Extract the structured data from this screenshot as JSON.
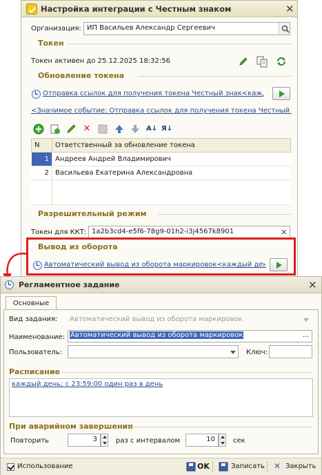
{
  "window1": {
    "title": "Настройка интеграции с Честным знаком",
    "organization_label": "Организация:",
    "organization_value": "ИП Васильев Александр Сергеевич",
    "token_section": "Токен",
    "token_status": "Токен активен до 25.12.2025 18:32:56",
    "update_section": "Обновление токена",
    "update_task_link": "Отправка ссылок для получения токена Честный знак<кажд...",
    "event_link": "<Значимое событие: Отправка ссылок для получения токена Честный ...",
    "table": {
      "columns": [
        "N",
        "Ответственный за обновление токена"
      ],
      "rows": [
        {
          "n": "1",
          "name": "Андреев Андрей Владимирович"
        },
        {
          "n": "2",
          "name": "Васильева Екатерина Александровна"
        }
      ]
    },
    "permit_section": "Разрешительный режим",
    "kkt_label": "Токен для ККТ:",
    "kkt_value": "1a2b3cd4-e5f6-78g9-01h2-i3j4567k8901",
    "withdrawal_section": "Вывод из оборота",
    "withdrawal_link": "Автоматический вывод из оборота маркировок<каждый день..."
  },
  "window2": {
    "title": "Регламентное задание",
    "tab": "Основные",
    "task_type_label": "Вид задания:",
    "task_type_value": "Автоматический вывод из оборота маркировок",
    "name_label": "Наименование:",
    "name_value": "Автоматический вывод из оборота маркировок",
    "user_label": "Пользователь:",
    "user_value": "",
    "key_label": "Ключ:",
    "key_value": "",
    "schedule_section": "Расписание",
    "schedule_link": "каждый день; с 23:59:00 один раз в день",
    "failure_section": "При аварийном завершении",
    "repeat_label": "Повторить",
    "repeat_value": "3",
    "interval_label": "раз с интервалом",
    "interval_value": "10",
    "sec_label": "сек",
    "use_label": "Использование",
    "ok_label": "OK",
    "save_label": "Записать",
    "close_label": "Закрыть"
  },
  "icons": {
    "edit": "pencil-icon",
    "copy": "copy-icon",
    "refresh": "refresh-icon",
    "add": "add-icon",
    "delete": "delete-icon",
    "move_up": "arrow-up-icon",
    "move_down": "arrow-down-icon",
    "sort_asc": "sort-asc-icon",
    "sort_desc": "sort-desc-icon"
  },
  "colors": {
    "highlight": "#e01c1c",
    "section": "#8c6f1e",
    "link": "#2a4a8f",
    "selection": "#3f65b5"
  }
}
